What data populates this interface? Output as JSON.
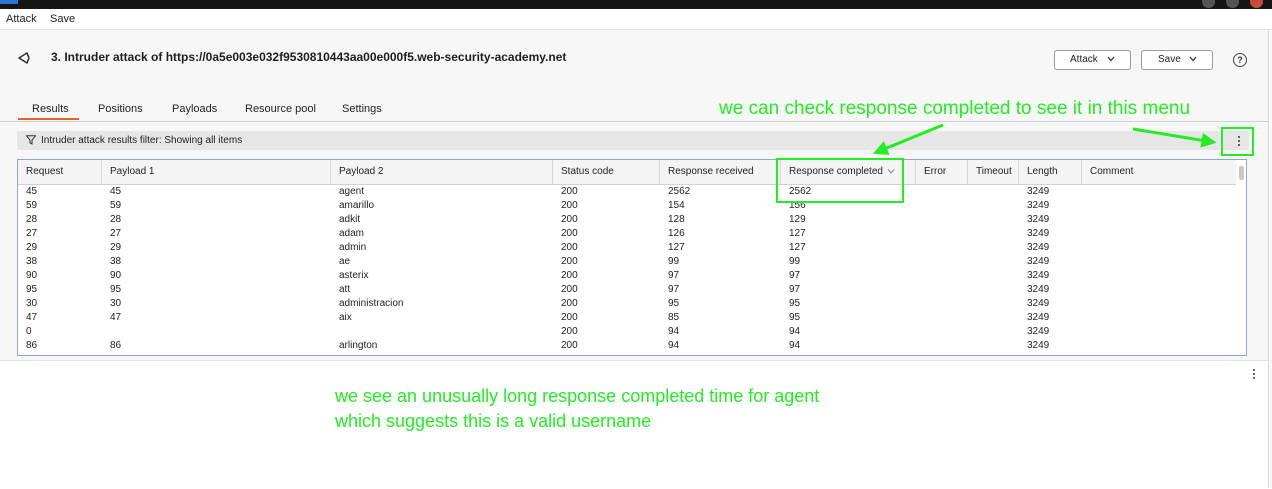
{
  "menubar": {
    "attack": "Attack",
    "save": "Save"
  },
  "header": {
    "title": "3. Intruder attack of https://0a5e003e032f9530810443aa00e000f5.web-security-academy.net"
  },
  "buttons": {
    "attack": "Attack",
    "save": "Save",
    "help": "?"
  },
  "tabs": [
    "Results",
    "Positions",
    "Payloads",
    "Resource pool",
    "Settings"
  ],
  "active_tab": "Results",
  "filter": {
    "label": "Intruder attack results filter: Showing all items"
  },
  "table": {
    "columns": [
      "Request",
      "Payload 1",
      "Payload 2",
      "Status code",
      "Response received",
      "Response completed",
      "Error",
      "Timeout",
      "Length",
      "Comment"
    ],
    "sorted_column": "Response completed",
    "rows": [
      [
        "45",
        "45",
        "agent",
        "200",
        "2562",
        "2562",
        "",
        "",
        "3249",
        ""
      ],
      [
        "59",
        "59",
        "amarillo",
        "200",
        "154",
        "156",
        "",
        "",
        "3249",
        ""
      ],
      [
        "28",
        "28",
        "adkit",
        "200",
        "128",
        "129",
        "",
        "",
        "3249",
        ""
      ],
      [
        "27",
        "27",
        "adam",
        "200",
        "126",
        "127",
        "",
        "",
        "3249",
        ""
      ],
      [
        "29",
        "29",
        "admin",
        "200",
        "127",
        "127",
        "",
        "",
        "3249",
        ""
      ],
      [
        "38",
        "38",
        "ae",
        "200",
        "99",
        "99",
        "",
        "",
        "3249",
        ""
      ],
      [
        "90",
        "90",
        "asterix",
        "200",
        "97",
        "97",
        "",
        "",
        "3249",
        ""
      ],
      [
        "95",
        "95",
        "att",
        "200",
        "97",
        "97",
        "",
        "",
        "3249",
        ""
      ],
      [
        "30",
        "30",
        "administracion",
        "200",
        "95",
        "95",
        "",
        "",
        "3249",
        ""
      ],
      [
        "47",
        "47",
        "aix",
        "200",
        "85",
        "95",
        "",
        "",
        "3249",
        ""
      ],
      [
        "0",
        "",
        "",
        "200",
        "94",
        "94",
        "",
        "",
        "3249",
        ""
      ],
      [
        "86",
        "86",
        "arlington",
        "200",
        "94",
        "94",
        "",
        "",
        "3249",
        ""
      ]
    ]
  },
  "annotations": {
    "top": "we can check response completed to see it in this menu",
    "bottom_line1": "we see an unusually long response completed time for agent",
    "bottom_line2": "which suggests this is a valid username"
  },
  "colors": {
    "annotation": "#22ee22",
    "tab_accent": "#e8622a",
    "table_border": "#8aa8d6"
  }
}
